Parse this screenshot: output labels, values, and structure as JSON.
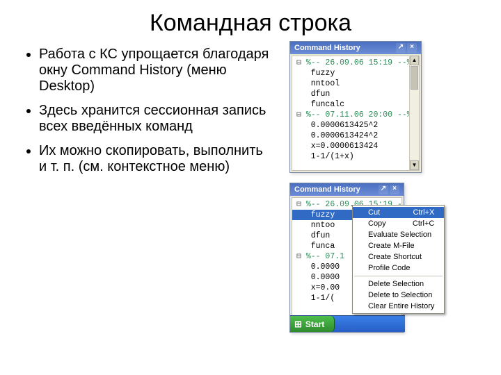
{
  "slide": {
    "title": "Командная строка",
    "bullets": [
      "Работа с КС упрощается благодаря окну Command History (меню Desktop)",
      "Здесь хранится сессионная запись всех введённых команд",
      "Их можно скопировать, выполнить и т. п. (см. контекстное меню)"
    ]
  },
  "panel_title": "Command History",
  "history1": {
    "items": [
      {
        "text": "%-- 26.09.06 15:19 --%",
        "session": true
      },
      {
        "text": "fuzzy"
      },
      {
        "text": "nntool"
      },
      {
        "text": "dfun"
      },
      {
        "text": "funcalc"
      },
      {
        "text": "%-- 07.11.06 20:00 --%",
        "session": true
      },
      {
        "text": "0.0000613425^2"
      },
      {
        "text": "0.0000613424^2"
      },
      {
        "text": "x=0.0000613424"
      },
      {
        "text": "1-1/(1+x)"
      }
    ]
  },
  "history2": {
    "items": [
      {
        "text": "%-- 26.09.06 15:19 --%",
        "session": true
      },
      {
        "text": "fuzzy",
        "selected": true
      },
      {
        "text": "nntoo"
      },
      {
        "text": "dfun"
      },
      {
        "text": "funca"
      },
      {
        "text": "%-- 07.1",
        "session": true
      },
      {
        "text": "0.0000"
      },
      {
        "text": "0.0000"
      },
      {
        "text": "x=0.00"
      },
      {
        "text": "1-1/("
      }
    ]
  },
  "context_menu": {
    "items": [
      {
        "label": "Cut",
        "shortcut": "Ctrl+X",
        "selected": true
      },
      {
        "label": "Copy",
        "shortcut": "Ctrl+C"
      },
      {
        "label": "Evaluate Selection"
      },
      {
        "label": "Create M-File"
      },
      {
        "label": "Create Shortcut"
      },
      {
        "label": "Profile Code"
      },
      {
        "sep": true
      },
      {
        "label": "Delete Selection"
      },
      {
        "label": "Delete to Selection"
      },
      {
        "label": "Clear Entire History"
      }
    ]
  },
  "taskbar": {
    "start": "Start"
  }
}
